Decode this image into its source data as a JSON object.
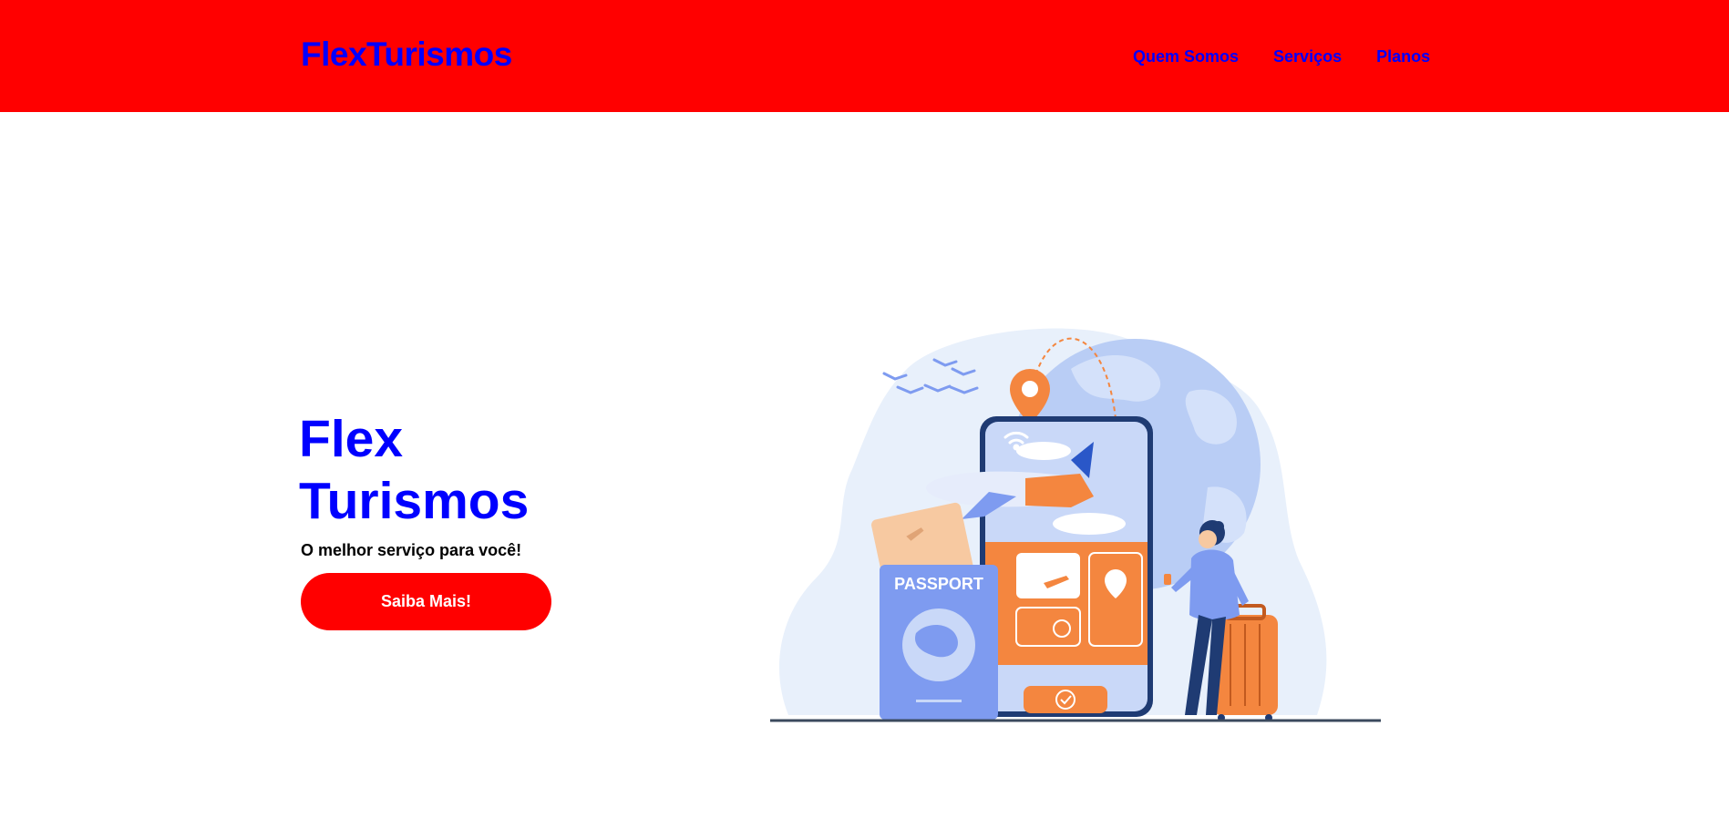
{
  "header": {
    "brand": "FlexTurismos",
    "nav": [
      {
        "label": "Quem Somos"
      },
      {
        "label": "Serviços"
      },
      {
        "label": "Planos"
      }
    ],
    "background_color": "#ff0000",
    "link_color": "#0000ff"
  },
  "hero": {
    "title": "Flex Turismos",
    "subtitle": "O melhor serviço para você!",
    "cta_label": "Saiba Mais!",
    "illustration": {
      "icon": "travel-illustration",
      "passport_label": "PASSPORT"
    }
  },
  "colors": {
    "accent": "#ff0000",
    "brand_text": "#0000ff",
    "illustration_orange": "#f4863f",
    "illustration_blue": "#7e9bf0"
  }
}
